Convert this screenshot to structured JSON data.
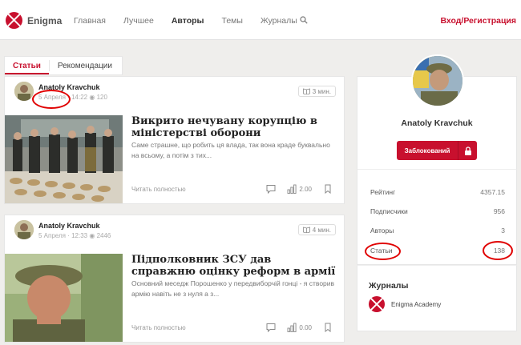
{
  "header": {
    "logo_text": "Enigma",
    "nav": [
      "Главная",
      "Лучшее",
      "Авторы",
      "Темы",
      "Журналы"
    ],
    "active_nav": "Авторы",
    "login_label": "Вход/Регистрация"
  },
  "tabs": [
    {
      "label": "Статьи",
      "active": true
    },
    {
      "label": "Рекомендации",
      "active": false
    }
  ],
  "articles": [
    {
      "author": "Anatoly Kravchuk",
      "date": "5 Апреля",
      "time": "14:22",
      "views": "120",
      "read_time": "3 мин.",
      "title": "Викрито нечувану корупцію в міністерстві оборони",
      "excerpt": "Саме страшне, що робить ця влада, так вона краде буквально на всьому, а потім з тих...",
      "read_more": "Читать полностью",
      "comments": "",
      "rating": "2.00"
    },
    {
      "author": "Anatoly Kravchuk",
      "date": "5 Апреля",
      "time": "12:33",
      "views": "2446",
      "read_time": "4 мин.",
      "title": "Підполковник ЗСУ дав справжню оцінку реформ в армії",
      "excerpt": "Основний меседж Порошенко у передвиборчій гонці - я створив армію навіть не з нуля а з...",
      "read_more": "Читать полностью",
      "comments": "",
      "rating": "0.00"
    }
  ],
  "profile": {
    "name": "Anatoly Kravchuk",
    "blocked_label": "Заблокований",
    "stats": [
      {
        "label": "Рейтинг",
        "value": "4357.15"
      },
      {
        "label": "Подписчики",
        "value": "956"
      },
      {
        "label": "Авторы",
        "value": "3"
      },
      {
        "label": "Статьи",
        "value": "138"
      }
    ]
  },
  "journals": {
    "title": "Журналы",
    "items": [
      "Enigma Academy"
    ]
  },
  "colors": {
    "brand": "#c8102e",
    "annotation": "#e00000"
  }
}
